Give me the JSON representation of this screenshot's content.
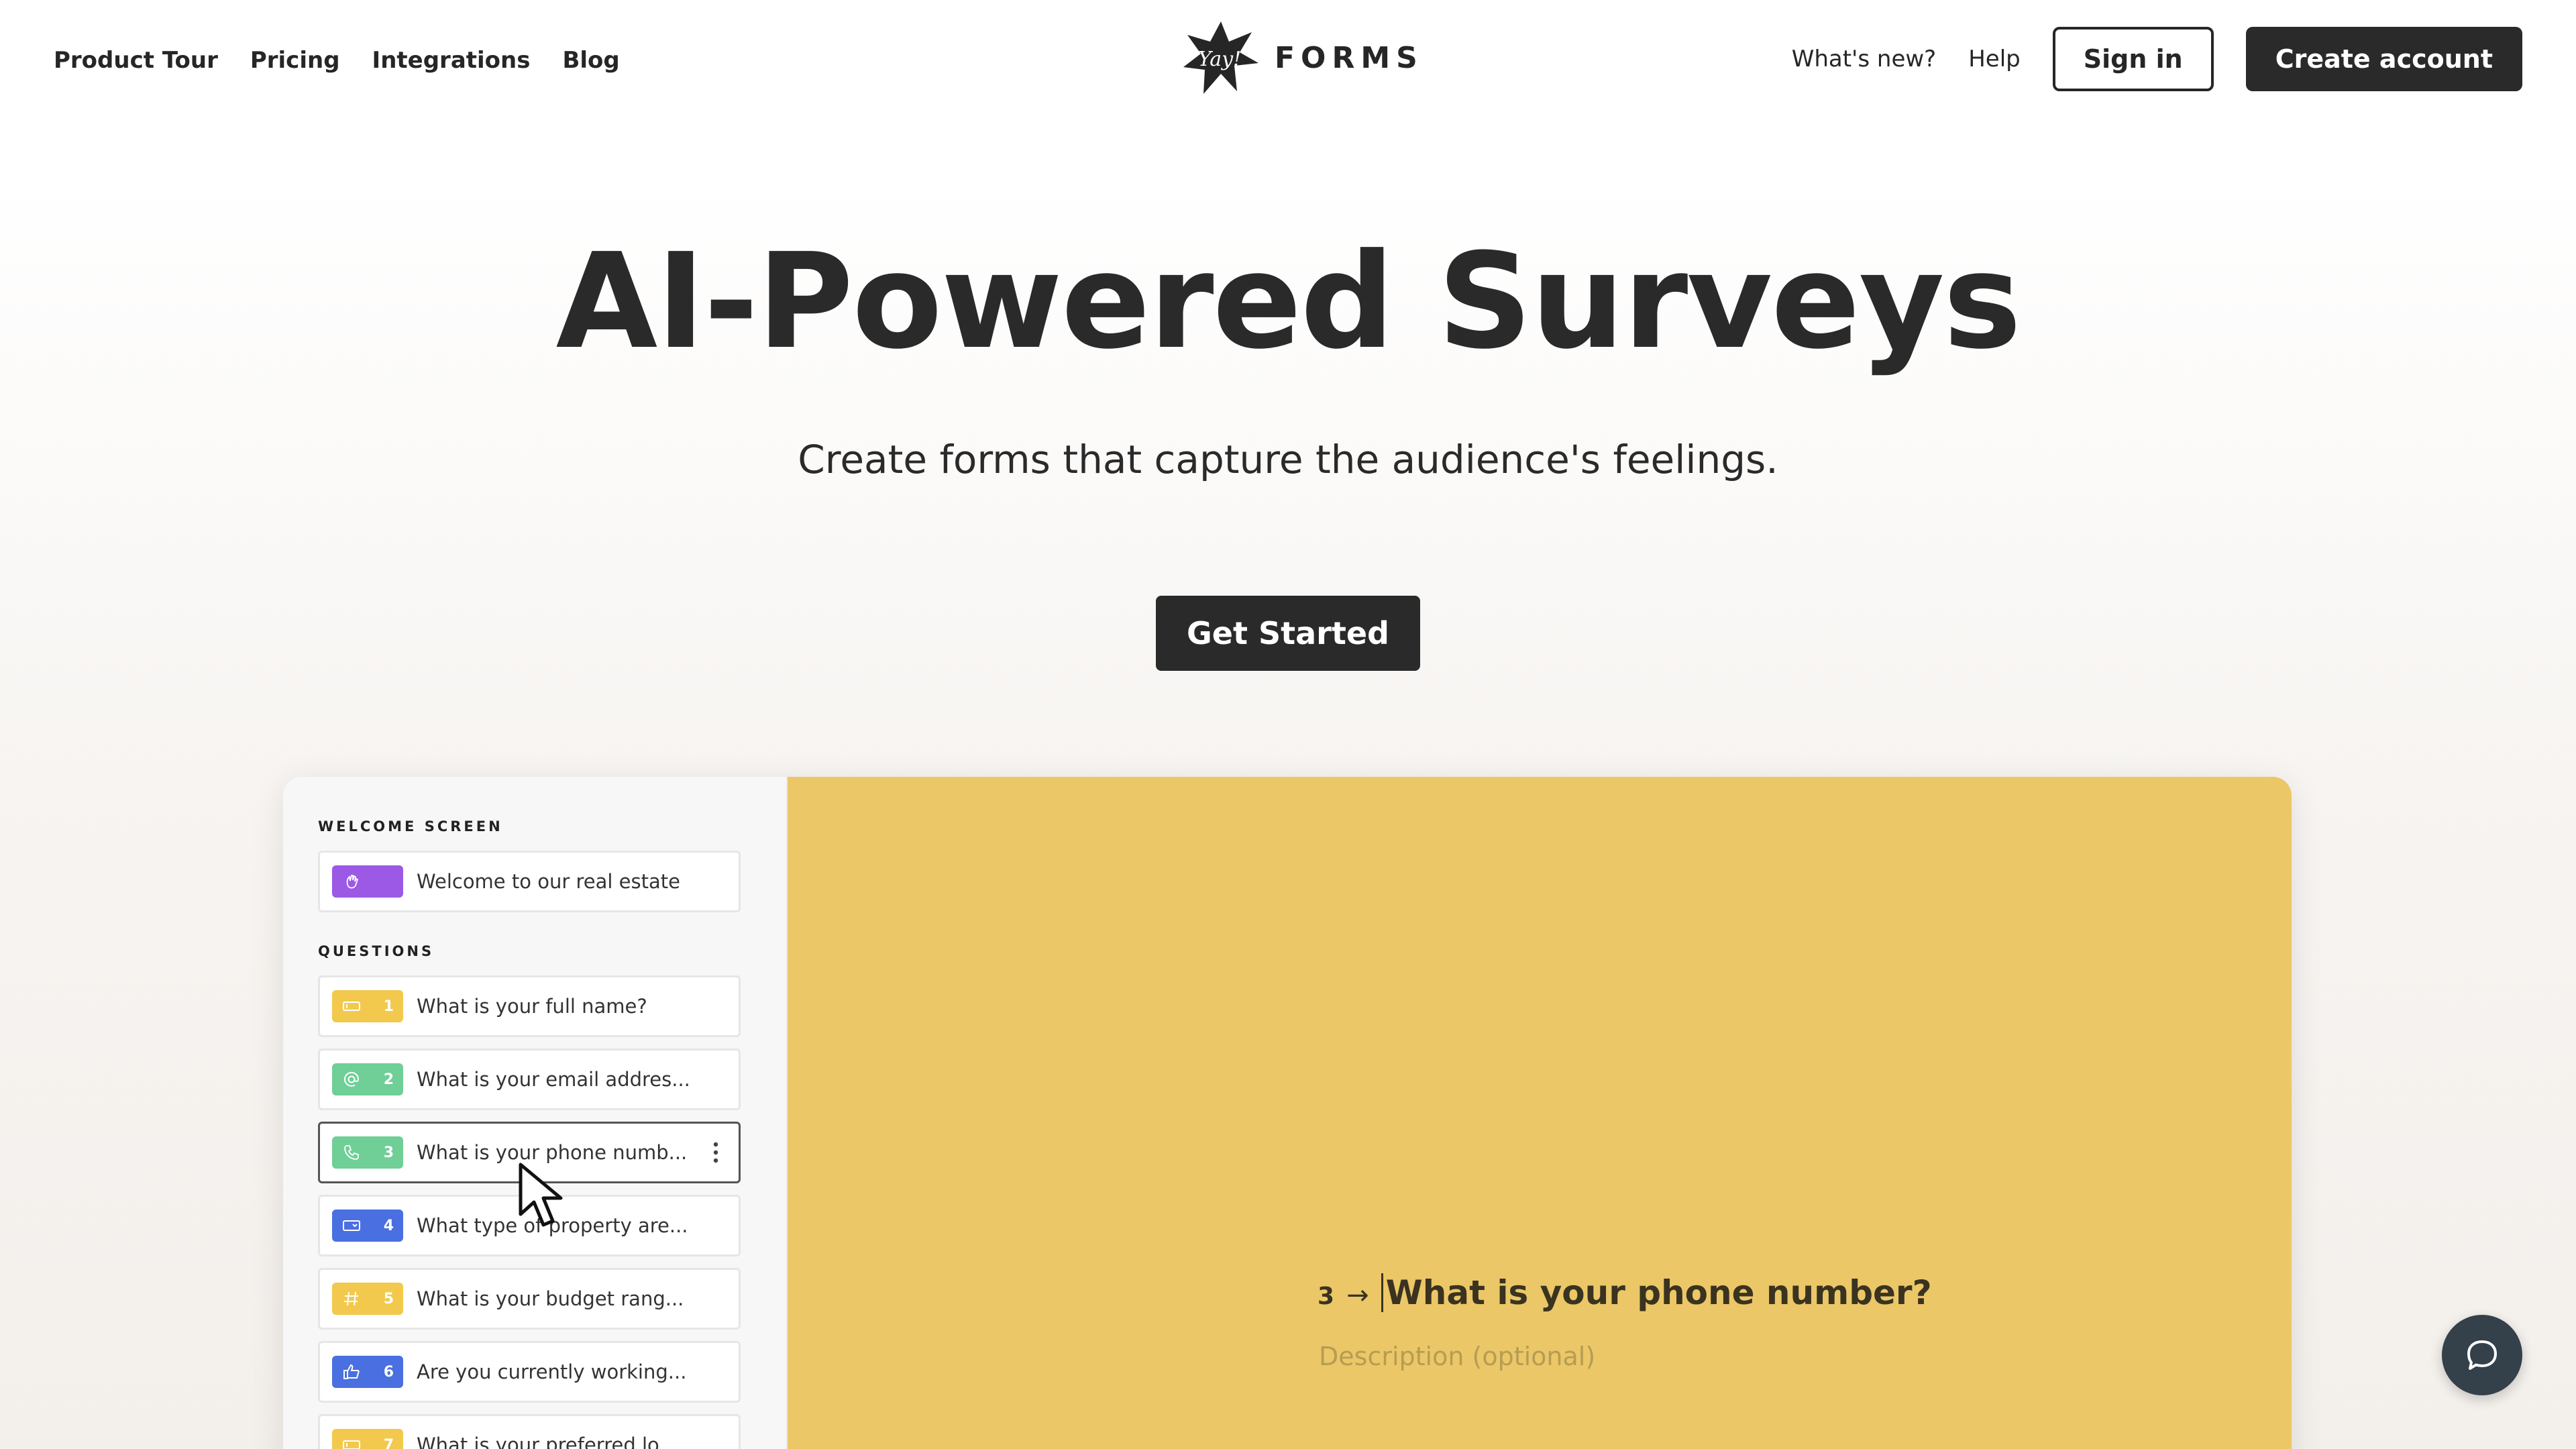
{
  "nav": {
    "links": [
      "Product Tour",
      "Pricing",
      "Integrations",
      "Blog"
    ],
    "brand_mark": "Yay!",
    "brand_name": "FORMS",
    "whats_new": "What's new?",
    "help": "Help",
    "sign_in": "Sign in",
    "create_account": "Create account"
  },
  "hero": {
    "title": "AI-Powered Surveys",
    "subtitle": "Create forms that capture the audience's feelings.",
    "cta": "Get Started"
  },
  "builder": {
    "welcome_heading": "WELCOME SCREEN",
    "welcome_item": "Welcome to our real estate",
    "questions_heading": "QUESTIONS",
    "questions": [
      {
        "num": "1",
        "icon": "short-text-icon",
        "color": "#f2c94c",
        "text": "What is your full name?"
      },
      {
        "num": "2",
        "icon": "at-sign-icon",
        "color": "#6fcf97",
        "text": "What is your email addres..."
      },
      {
        "num": "3",
        "icon": "phone-icon",
        "color": "#6fcf97",
        "text": "What is your phone numb...",
        "active": true
      },
      {
        "num": "4",
        "icon": "dropdown-icon",
        "color": "#4a6fe0",
        "text": "What type of property are..."
      },
      {
        "num": "5",
        "icon": "hash-icon",
        "color": "#f2c94c",
        "text": "What is your budget rang..."
      },
      {
        "num": "6",
        "icon": "thumbs-up-icon",
        "color": "#4a6fe0",
        "text": "Are you currently working..."
      },
      {
        "num": "7",
        "icon": "short-text-icon",
        "color": "#f2c94c",
        "text": "What is your preferred lo..."
      }
    ],
    "welcome_color": "#9b59e6",
    "preview": {
      "number": "3",
      "arrow": "→",
      "question": "What is your phone number?",
      "description_placeholder": "Description (optional)"
    },
    "canvas_color": "#ebc767"
  },
  "colors": {
    "dark": "#2a2a2a",
    "chat_bubble": "#34404a"
  }
}
